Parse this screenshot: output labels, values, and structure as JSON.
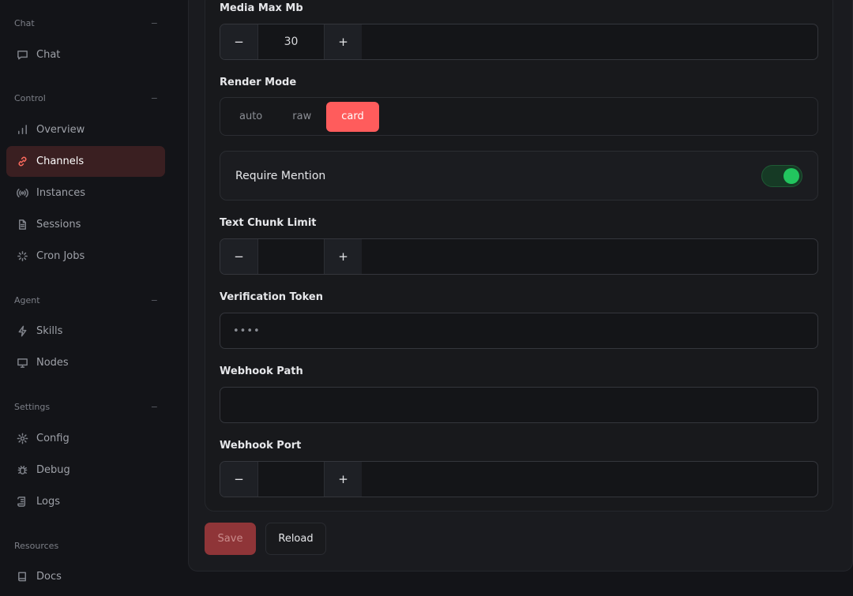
{
  "sidebar": {
    "sections": [
      {
        "label": "Chat",
        "collapse": "−",
        "items": [
          {
            "label": "Chat",
            "icon": "chat-bubble-icon"
          }
        ]
      },
      {
        "label": "Control",
        "collapse": "−",
        "items": [
          {
            "label": "Overview",
            "icon": "bar-chart-icon"
          },
          {
            "label": "Channels",
            "icon": "link-icon",
            "active": true
          },
          {
            "label": "Instances",
            "icon": "radio-signal-icon"
          },
          {
            "label": "Sessions",
            "icon": "document-icon"
          },
          {
            "label": "Cron Jobs",
            "icon": "loader-icon"
          }
        ]
      },
      {
        "label": "Agent",
        "collapse": "−",
        "items": [
          {
            "label": "Skills",
            "icon": "lightning-icon"
          },
          {
            "label": "Nodes",
            "icon": "monitor-icon"
          }
        ]
      },
      {
        "label": "Settings",
        "collapse": "−",
        "items": [
          {
            "label": "Config",
            "icon": "gear-icon"
          },
          {
            "label": "Debug",
            "icon": "bug-icon"
          },
          {
            "label": "Logs",
            "icon": "scroll-icon"
          }
        ]
      },
      {
        "label": "Resources",
        "collapse": "",
        "items": [
          {
            "label": "Docs",
            "icon": "book-icon"
          }
        ]
      }
    ]
  },
  "form": {
    "media_max_mb": {
      "label": "Media Max Mb",
      "value": "30",
      "minus": "−",
      "plus": "+"
    },
    "render_mode": {
      "label": "Render Mode",
      "options": [
        "auto",
        "raw",
        "card"
      ],
      "selected": "card"
    },
    "require_mention": {
      "label": "Require Mention",
      "enabled": true
    },
    "text_chunk_limit": {
      "label": "Text Chunk Limit",
      "value": "",
      "minus": "−",
      "plus": "+"
    },
    "verification_token": {
      "label": "Verification Token",
      "value": "••••"
    },
    "webhook_path": {
      "label": "Webhook Path",
      "value": ""
    },
    "webhook_port": {
      "label": "Webhook Port",
      "value": "",
      "minus": "−",
      "plus": "+"
    }
  },
  "actions": {
    "save": "Save",
    "reload": "Reload"
  },
  "colors": {
    "accent": "#ff5c5c",
    "toggle_on": "#22c55e",
    "active_nav_bg": "#3a1f21"
  }
}
